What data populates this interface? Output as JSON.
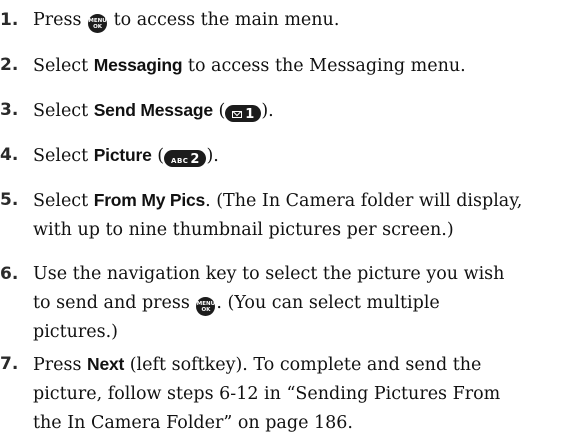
{
  "steps": [
    {
      "num": "1.",
      "p1": "Press ",
      "icon": "menu-ok-key-icon",
      "icon_top": "MENU",
      "icon_bottom": "OK",
      "p2": " to access the main menu."
    },
    {
      "num": "2.",
      "p1": "Select ",
      "bold": "Messaging",
      "p2": " to access the Messaging menu."
    },
    {
      "num": "3.",
      "p1": "Select ",
      "bold": "Send Message",
      "p2": " (",
      "key_icon": "envelope-icon",
      "key_big": "1",
      "p3": ")."
    },
    {
      "num": "4.",
      "p1": "Select ",
      "bold": "Picture",
      "p2": " (",
      "key_small": "ABC",
      "key_big": "2",
      "p3": ")."
    },
    {
      "num": "5.",
      "p1": "Select ",
      "bold": "From My Pics",
      "p2": ". (The In Camera folder will display,\nwith up to nine thumbnail pictures per screen.)"
    },
    {
      "num": "6.",
      "p1": "Use the navigation key to select the picture you wish\nto send and press ",
      "icon": "menu-ok-key-icon",
      "icon_top": "MENU",
      "icon_bottom": "OK",
      "p2": ". (You can select multiple\npictures.)"
    },
    {
      "num": "7.",
      "p1": "Press ",
      "bold": "Next",
      "p2": " (left softkey). To complete and send the\npicture, follow steps 6-12 in “Sending Pictures From\nthe In Camera Folder” on page 186."
    }
  ]
}
